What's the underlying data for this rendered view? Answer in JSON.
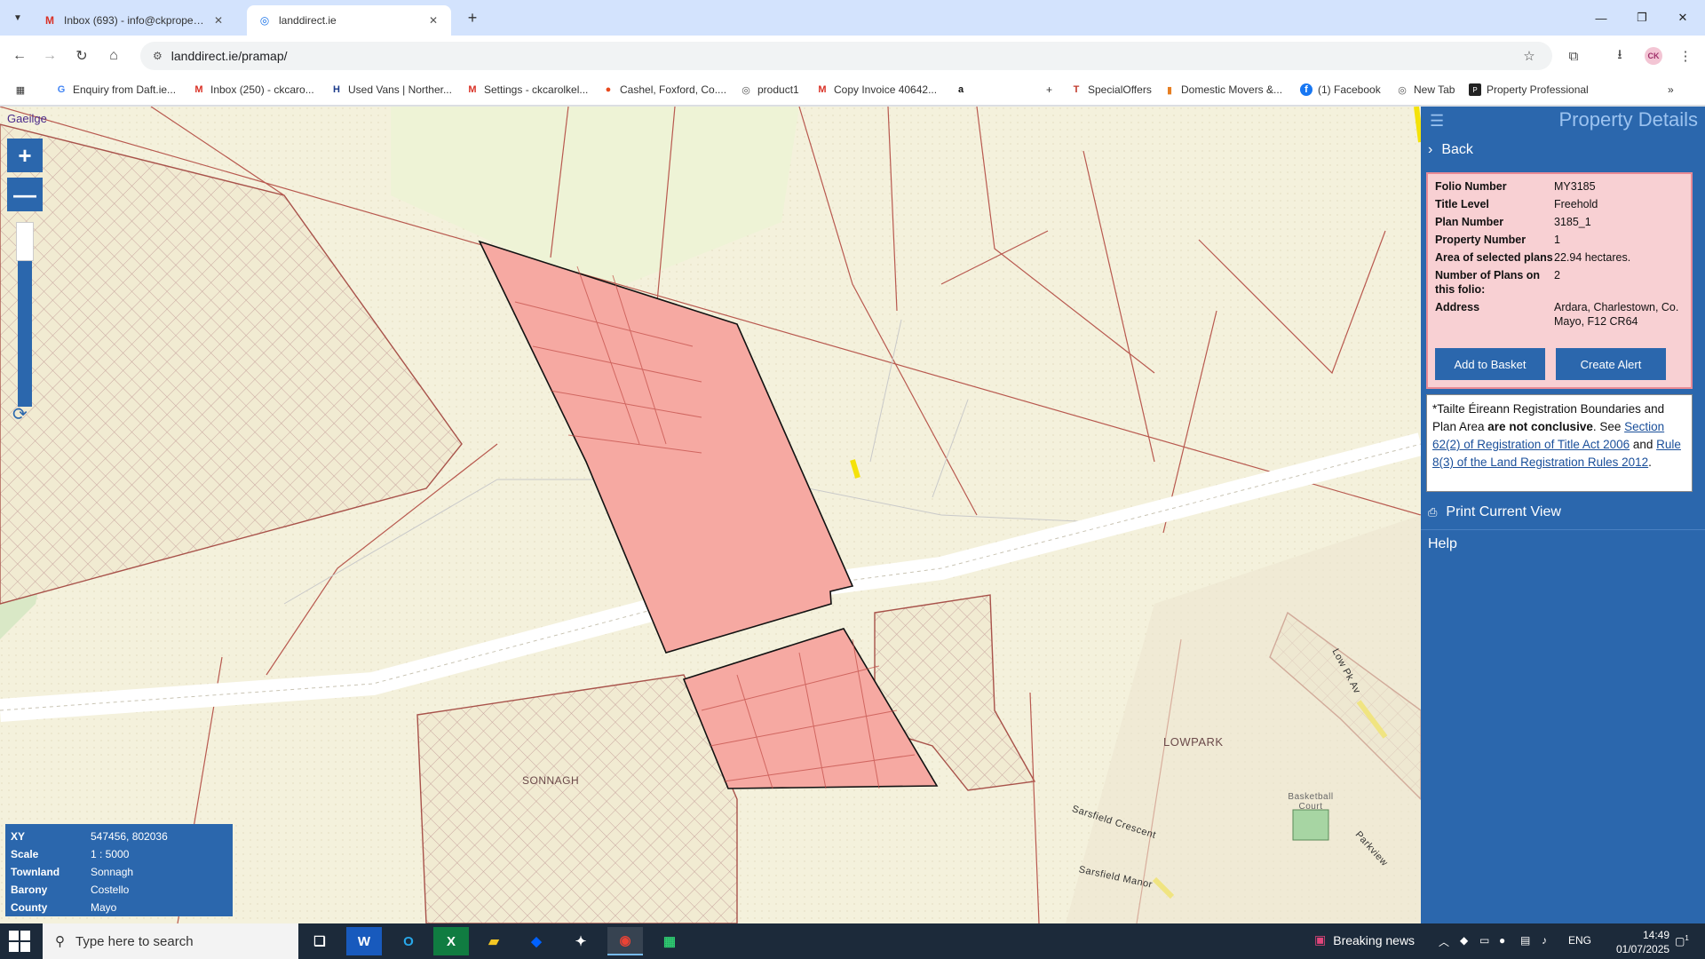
{
  "browser": {
    "tabs": [
      {
        "title": "Inbox (693) - info@ckpropertie",
        "icon": "gmail-icon",
        "close": "✕"
      },
      {
        "title": "landdirect.ie",
        "icon": "globe-icon",
        "close": "✕"
      }
    ],
    "new_tab": "+",
    "window": {
      "minimize": "—",
      "maximize": "❐",
      "close": "✕"
    },
    "url": "landdirect.ie/pramap/",
    "bookmarks": [
      {
        "label": "Enquiry from Daft.ie...",
        "icon": "google-icon"
      },
      {
        "label": "Inbox (250) - ckcaro...",
        "icon": "gmail-icon"
      },
      {
        "label": "Used Vans | Norther...",
        "icon": "h-icon"
      },
      {
        "label": "Settings - ckcarolkel...",
        "icon": "gmail-icon"
      },
      {
        "label": "Cashel, Foxford, Co....",
        "icon": "daft-icon"
      },
      {
        "label": "product1",
        "icon": "globe-icon"
      },
      {
        "label": "Copy Invoice 40642...",
        "icon": "gmail-icon"
      },
      {
        "label": "",
        "icon": "amazon-icon"
      },
      {
        "label": "+",
        "icon": ""
      },
      {
        "label": "SpecialOffers",
        "icon": "t-icon"
      },
      {
        "label": "Domestic Movers &...",
        "icon": "bars-icon"
      },
      {
        "label": "(1) Facebook",
        "icon": "facebook-icon"
      },
      {
        "label": "New Tab",
        "icon": "globe-icon"
      },
      {
        "label": "Property Professional",
        "icon": "pp-icon"
      }
    ]
  },
  "map": {
    "language_link": "Gaeilge",
    "zoom_in": "+",
    "zoom_out": "—",
    "labels": {
      "lowpark": "LOWPARK",
      "sonnagh": "SONNAGH",
      "low_pk_av": "Low Pk Av",
      "sarsfield_crescent": "Sarsfield Crescent",
      "sarsfield_manor": "Sarsfield Manor",
      "parkview": "Parkview",
      "basketball": "Basketball Court"
    },
    "info": [
      {
        "key": "XY",
        "value": "547456, 802036"
      },
      {
        "key": "Scale",
        "value": "1 : 5000"
      },
      {
        "key": "Townland",
        "value": "Sonnagh"
      },
      {
        "key": "Barony",
        "value": "Costello"
      },
      {
        "key": "County",
        "value": "Mayo"
      }
    ]
  },
  "sidebar": {
    "title": "Property Details",
    "back": "Back",
    "details": [
      {
        "key": "Folio Number",
        "value": "MY3185"
      },
      {
        "key": "Title Level",
        "value": "Freehold"
      },
      {
        "key": "Plan Number",
        "value": "3185_1"
      },
      {
        "key": "Property Number",
        "value": "1"
      },
      {
        "key": "Area of selected plans",
        "value": "22.94 hectares."
      },
      {
        "key": "Number of Plans on this folio:",
        "value": "2"
      },
      {
        "key": "Address",
        "value": "Ardara, Charlestown, Co. Mayo, F12 CR64"
      }
    ],
    "add_to_basket": "Add to Basket",
    "create_alert": "Create Alert",
    "disclaimer": {
      "p1": "*Tailte Éireann Registration Boundaries and Plan Area ",
      "bold": "are not conclusive",
      "p2": ". See ",
      "link1": "Section 62(2) of Registration of Title Act 2006",
      "p3": " and ",
      "link2": "Rule 8(3) of the Land Registration Rules 2012",
      "p4": "."
    },
    "print": "Print Current View",
    "help": "Help"
  },
  "taskbar": {
    "search_placeholder": "Type here to search",
    "news": "Breaking news",
    "lang": "ENG",
    "time": "14:49",
    "date": "01/07/2025",
    "notif_count": "1"
  },
  "colors": {
    "accent": "#2b67ad",
    "parcel_fill": "#f4a6a0",
    "parcel_border": "#e98a95"
  }
}
